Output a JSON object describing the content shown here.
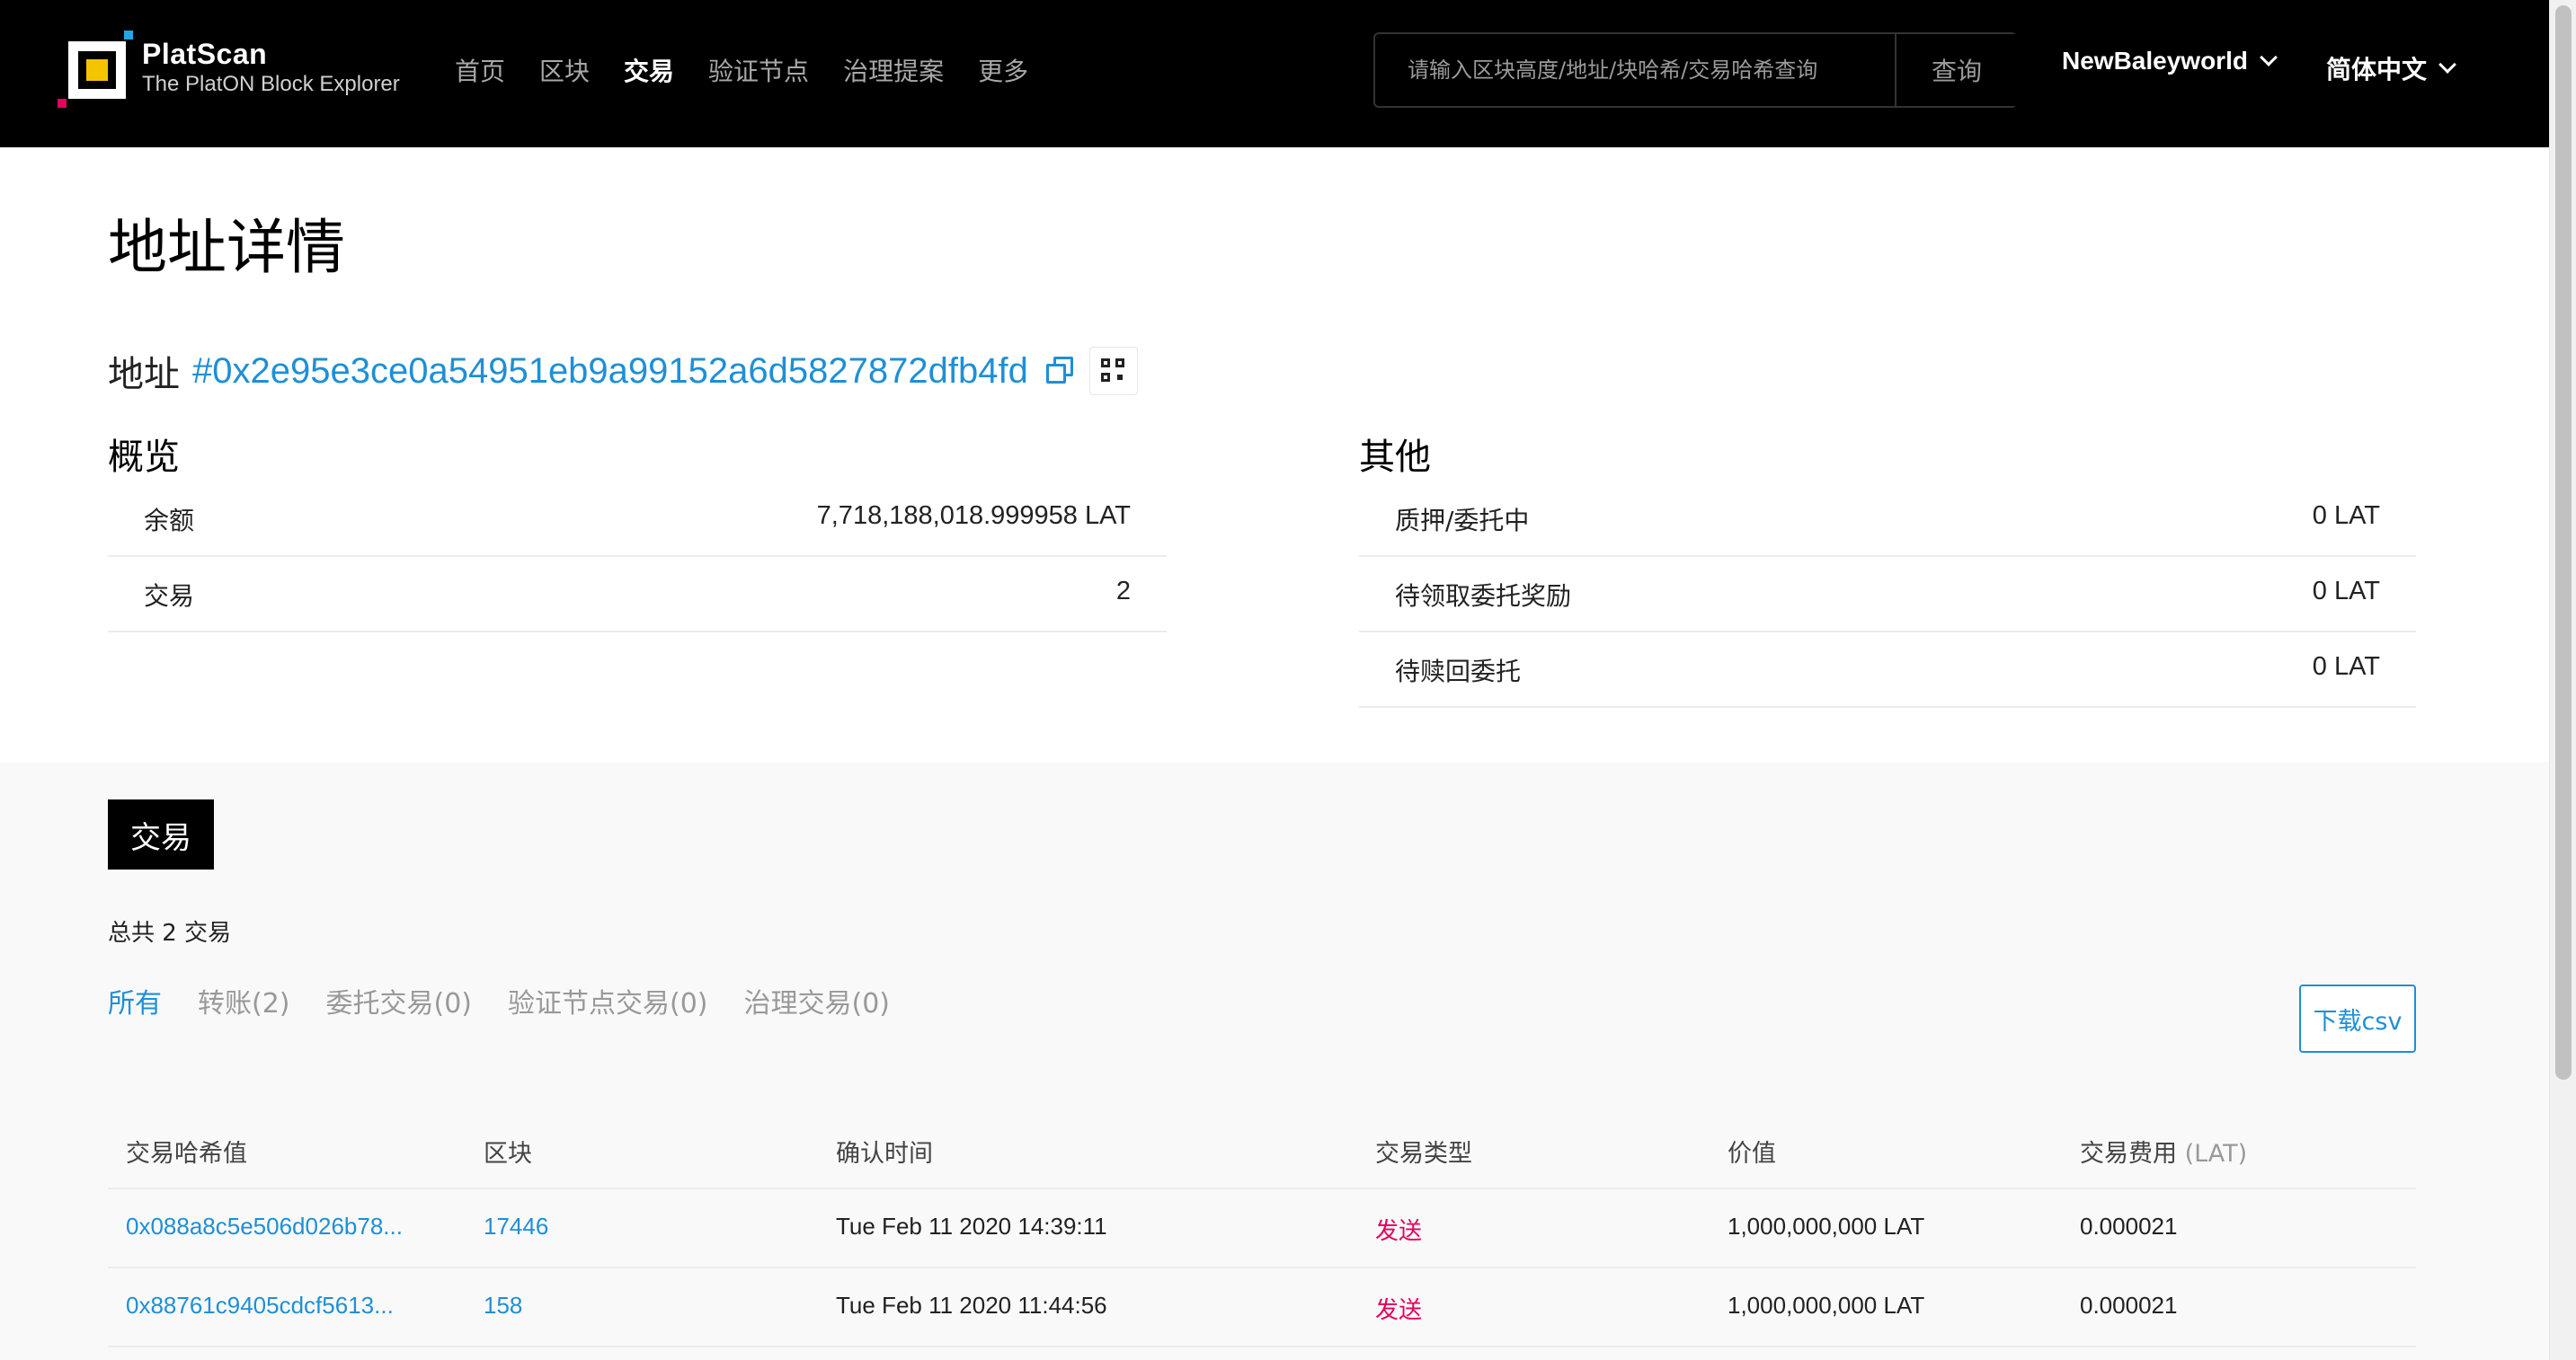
{
  "header": {
    "logo_title": "PlatScan",
    "logo_subtitle": "The PlatON Block Explorer",
    "nav": [
      "首页",
      "区块",
      "交易",
      "验证节点",
      "治理提案",
      "更多"
    ],
    "nav_active": "交易",
    "search_placeholder": "请输入区块高度/地址/块哈希/交易哈希查询",
    "search_button": "查询",
    "network": "NewBaleyworld",
    "language": "简体中文"
  },
  "page": {
    "title": "地址详情",
    "address_label": "地址",
    "address": "#0x2e95e3ce0a54951eb9a99152a6d5827872dfb4fd"
  },
  "overview": {
    "heading": "概览",
    "rows": [
      {
        "label": "余额",
        "value": "7,718,188,018.999958 LAT"
      },
      {
        "label": "交易",
        "value": "2"
      }
    ]
  },
  "other": {
    "heading": "其他",
    "rows": [
      {
        "label": "质押/委托中",
        "value": "0 LAT"
      },
      {
        "label": "待领取委托奖励",
        "value": "0 LAT"
      },
      {
        "label": "待赎回委托",
        "value": "0 LAT"
      }
    ]
  },
  "transactions": {
    "badge": "交易",
    "total": "总共 2 交易",
    "tabs": [
      "所有",
      "转账(2)",
      "委托交易(0)",
      "验证节点交易(0)",
      "治理交易(0)"
    ],
    "active_tab": "所有",
    "csv_button": "下载csv",
    "columns": [
      "交易哈希值",
      "区块",
      "确认时间",
      "交易类型",
      "价值",
      "交易费用"
    ],
    "fee_unit": "(LAT)",
    "rows": [
      {
        "hash": "0x088a8c5e506d026b78...",
        "block": "17446",
        "time": "Tue Feb 11 2020 14:39:11",
        "type": "发送",
        "value": "1,000,000,000 LAT",
        "fee": "0.000021"
      },
      {
        "hash": "0x88761c9405cdcf5613...",
        "block": "158",
        "time": "Tue Feb 11 2020 11:44:56",
        "type": "发送",
        "value": "1,000,000,000 LAT",
        "fee": "0.000021"
      }
    ]
  },
  "colors": {
    "header_bg": "#000000",
    "link_blue": "#1f8fd6",
    "send_pink": "#e6005a",
    "logo_yellow": "#f5c400"
  }
}
